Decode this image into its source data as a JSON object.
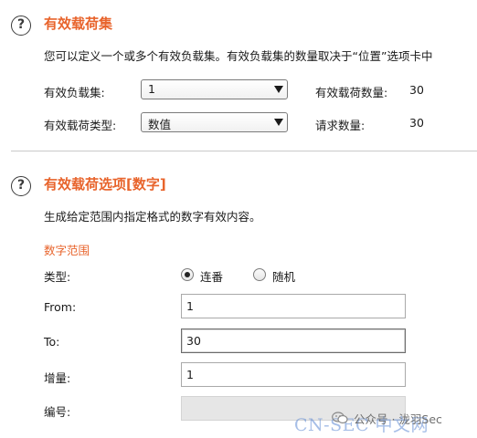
{
  "payload_sets": {
    "title": "有效载荷集",
    "description": "您可以定义一个或多个有效负载集。有效负载集的数量取决于“位置”选项卡中",
    "set_label": "有效负载集:",
    "set_value": "1",
    "type_label": "有效载荷类型:",
    "type_value": "数值",
    "count_label": "有效载荷数量:",
    "count_value": "30",
    "requests_label": "请求数量:",
    "requests_value": "30"
  },
  "payload_options": {
    "title": "有效载荷选项[数字]",
    "description": "生成给定范围内指定格式的数字有效内容。",
    "range_heading": "数字范围",
    "type_label": "类型:",
    "radio_sequential": "连番",
    "radio_random": "随机",
    "selected_type": "sequential",
    "from_label": "From:",
    "from_value": "1",
    "to_label": "To:",
    "to_value": "30",
    "step_label": "增量:",
    "step_value": "1",
    "number_label": "编号:",
    "number_value": ""
  },
  "help_icon_glyph": "?",
  "watermark": {
    "text": "公众号 · 泷羽Sec",
    "site": "CN-SEC 中文网"
  },
  "colors": {
    "accent": "#e8642c",
    "divider": "#c9c9c9",
    "disabled_field": "#e6e6e6"
  }
}
